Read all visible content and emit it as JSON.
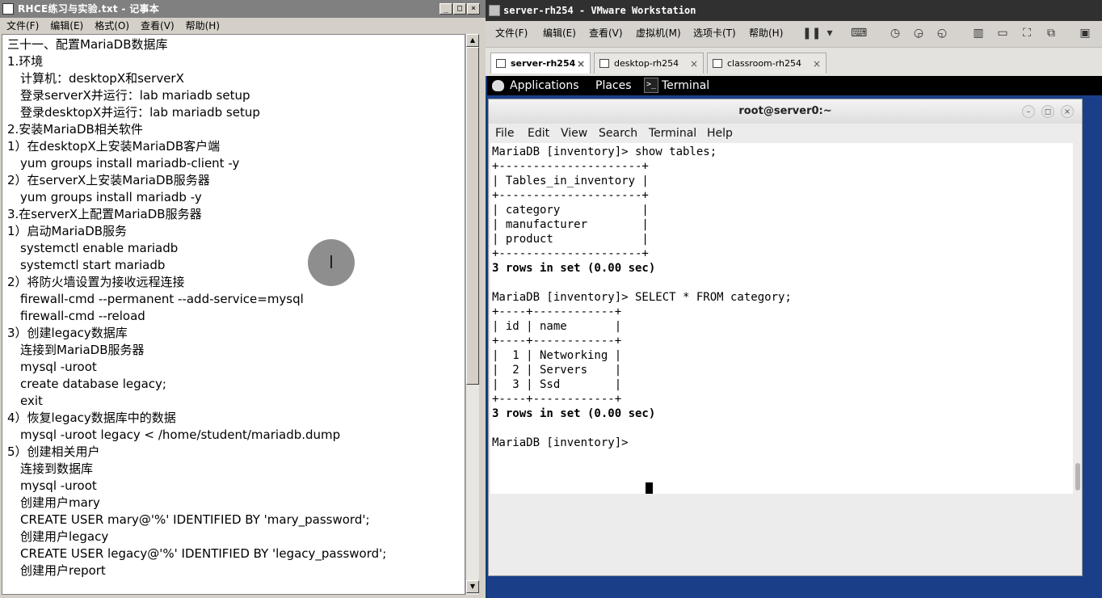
{
  "notepad": {
    "title": "RHCE练习与实验.txt - 记事本",
    "menu": [
      "文件(F)",
      "编辑(E)",
      "格式(O)",
      "查看(V)",
      "帮助(H)"
    ],
    "window_buttons": [
      "_",
      "□",
      "×"
    ],
    "lines": [
      {
        "text": "三十一、配置MariaDB数据库",
        "indent": false
      },
      {
        "text": "1.环境",
        "indent": false
      },
      {
        "text": "计算机：desktopX和serverX",
        "indent": true
      },
      {
        "text": "登录serverX并运行：lab mariadb setup",
        "indent": true
      },
      {
        "text": "登录desktopX并运行：lab mariadb setup",
        "indent": true
      },
      {
        "text": "2.安装MariaDB相关软件",
        "indent": false
      },
      {
        "text": "1）在desktopX上安装MariaDB客户端",
        "indent": false
      },
      {
        "text": "yum groups install mariadb-client -y",
        "indent": true
      },
      {
        "text": "2）在serverX上安装MariaDB服务器",
        "indent": false
      },
      {
        "text": "yum groups install mariadb -y",
        "indent": true
      },
      {
        "text": "3.在serverX上配置MariaDB服务器",
        "indent": false
      },
      {
        "text": "1）启动MariaDB服务",
        "indent": false
      },
      {
        "text": "systemctl enable mariadb",
        "indent": true
      },
      {
        "text": "systemctl start mariadb",
        "indent": true
      },
      {
        "text": "2）将防火墙设置为接收远程连接",
        "indent": false
      },
      {
        "text": "firewall-cmd --permanent --add-service=mysql",
        "indent": true
      },
      {
        "text": "firewall-cmd --reload",
        "indent": true
      },
      {
        "text": "3）创建legacy数据库",
        "indent": false
      },
      {
        "text": "连接到MariaDB服务器",
        "indent": true
      },
      {
        "text": "mysql -uroot",
        "indent": true
      },
      {
        "text": "create database legacy;",
        "indent": true
      },
      {
        "text": "exit",
        "indent": true
      },
      {
        "text": "4）恢复legacy数据库中的数据",
        "indent": false
      },
      {
        "text": "mysql -uroot legacy < /home/student/mariadb.dump",
        "indent": true
      },
      {
        "text": "5）创建相关用户",
        "indent": false
      },
      {
        "text": "连接到数据库",
        "indent": true
      },
      {
        "text": "mysql -uroot",
        "indent": true
      },
      {
        "text": "创建用户mary",
        "indent": true
      },
      {
        "text": "CREATE USER mary@'%' IDENTIFIED BY 'mary_password';",
        "indent": true
      },
      {
        "text": "创建用户legacy",
        "indent": true
      },
      {
        "text": "CREATE USER legacy@'%' IDENTIFIED BY 'legacy_password';",
        "indent": true
      },
      {
        "text": "创建用户report",
        "indent": true
      }
    ]
  },
  "vmware": {
    "title": "server-rh254 - VMware Workstation",
    "menu": [
      "文件(F)",
      "编辑(E)",
      "查看(V)",
      "虚拟机(M)",
      "选项卡(T)",
      "帮助(H)"
    ],
    "tabs": [
      {
        "label": "server-rh254",
        "active": true
      },
      {
        "label": "desktop-rh254",
        "active": false
      },
      {
        "label": "classroom-rh254",
        "active": false
      }
    ],
    "tab_close": "×"
  },
  "gnome": {
    "applications": "Applications",
    "places": "Places",
    "terminal": "Terminal"
  },
  "terminal": {
    "title": "root@server0:~",
    "controls": [
      "–",
      "◻",
      "×"
    ],
    "menu": [
      "File",
      "Edit",
      "View",
      "Search",
      "Terminal",
      "Help"
    ],
    "lines": [
      {
        "text": "MariaDB [inventory]> show tables;",
        "bold": false
      },
      {
        "text": "+---------------------+",
        "bold": false
      },
      {
        "text": "| Tables_in_inventory |",
        "bold": false
      },
      {
        "text": "+---------------------+",
        "bold": false
      },
      {
        "text": "| category            |",
        "bold": false
      },
      {
        "text": "| manufacturer        |",
        "bold": false
      },
      {
        "text": "| product             |",
        "bold": false
      },
      {
        "text": "+---------------------+",
        "bold": false
      },
      {
        "text": "3 rows in set (0.00 sec)",
        "bold": true
      },
      {
        "text": "",
        "bold": false
      },
      {
        "text": "MariaDB [inventory]> SELECT * FROM category;",
        "bold": false
      },
      {
        "text": "+----+------------+",
        "bold": false
      },
      {
        "text": "| id | name       |",
        "bold": false
      },
      {
        "text": "+----+------------+",
        "bold": false
      },
      {
        "text": "|  1 | Networking |",
        "bold": false
      },
      {
        "text": "|  2 | Servers    |",
        "bold": false
      },
      {
        "text": "|  3 | Ssd        |",
        "bold": false
      },
      {
        "text": "+----+------------+",
        "bold": false
      },
      {
        "text": "3 rows in set (0.00 sec)",
        "bold": true
      },
      {
        "text": "",
        "bold": false
      },
      {
        "text": "MariaDB [inventory]> ",
        "bold": false
      }
    ]
  }
}
